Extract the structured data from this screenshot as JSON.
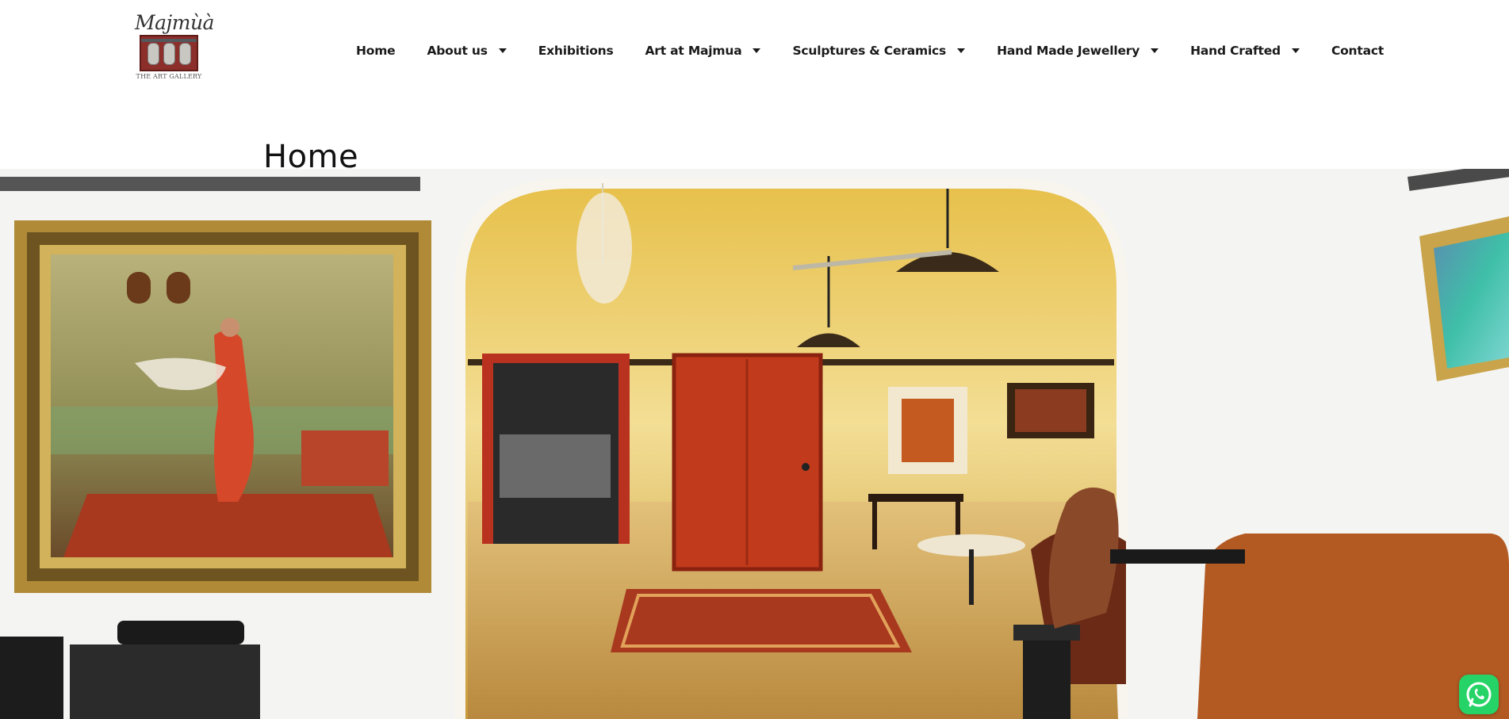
{
  "logo": {
    "wordmark": "Majmùà",
    "tagline": "THE ART GALLERY"
  },
  "nav": [
    {
      "label": "Home",
      "has_dropdown": false
    },
    {
      "label": "About us",
      "has_dropdown": true
    },
    {
      "label": "Exhibitions",
      "has_dropdown": false
    },
    {
      "label": "Art at Majmua",
      "has_dropdown": true
    },
    {
      "label": "Sculptures & Ceramics",
      "has_dropdown": true
    },
    {
      "label": "Hand Made Jewellery",
      "has_dropdown": true
    },
    {
      "label": "Hand Crafted",
      "has_dropdown": true
    },
    {
      "label": "Contact",
      "has_dropdown": false
    }
  ],
  "page": {
    "title": "Home"
  },
  "icons": {
    "dropdown": "caret-down-icon",
    "chat": "whatsapp-icon"
  },
  "colors": {
    "text": "#1a1a1a",
    "whatsapp": "#25d366"
  }
}
